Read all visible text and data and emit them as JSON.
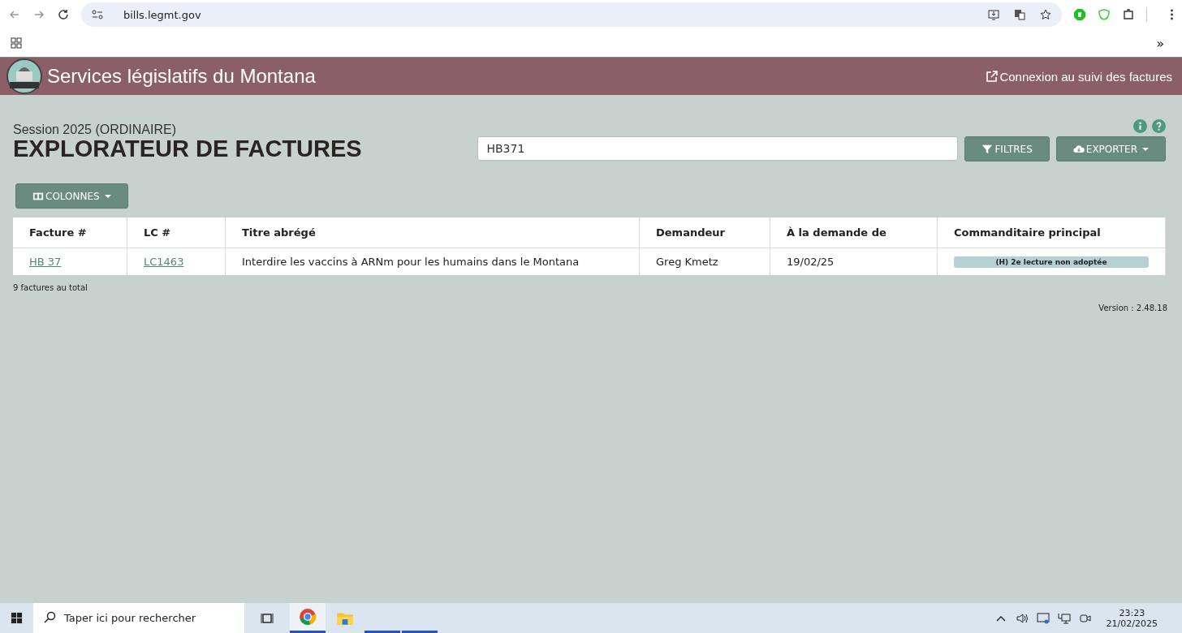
{
  "browser": {
    "url": "bills.legmt.gov",
    "bookmarks_more": "»"
  },
  "header": {
    "title": "Services législatifs du Montana",
    "login_link": "Connexion au suivi des factures"
  },
  "page": {
    "session": "Session 2025 (ORDINAIRE)",
    "title": "EXPLORATEUR DE FACTURES",
    "search": {
      "value": "HB371"
    },
    "filter_button": "FILTRES",
    "export_button": "EXPORTER",
    "columns_button": "COLONNES"
  },
  "table": {
    "columns": [
      "Facture #",
      "LC #",
      "Titre abrégé",
      "Demandeur",
      "À la demande de",
      "Commanditaire principal"
    ],
    "rows": [
      [
        {
          "kind": "link",
          "text": "HB 37"
        },
        {
          "kind": "link",
          "text": "LC1463"
        },
        {
          "kind": "text",
          "text": "Interdire les vaccins à ARNm pour les humains dans le Montana"
        },
        {
          "kind": "text",
          "text": "Greg Kmetz"
        },
        {
          "kind": "text",
          "text": "19/02/25"
        },
        {
          "kind": "status",
          "text": "(H) 2e lecture non adoptée"
        }
      ]
    ]
  },
  "total": "9 factures au total",
  "version": "Version : 2.48.18",
  "taskbar": {
    "search_placeholder": "Taper ici pour rechercher",
    "apps": [
      {
        "kind": "chrome",
        "selected": true,
        "running": true
      },
      {
        "kind": "folder",
        "selected": false,
        "running": false
      },
      {
        "kind": "blank",
        "selected": false,
        "running": true
      },
      {
        "kind": "blank",
        "selected": false,
        "running": true
      }
    ],
    "time": "23:23",
    "date": "21/02/2025"
  }
}
